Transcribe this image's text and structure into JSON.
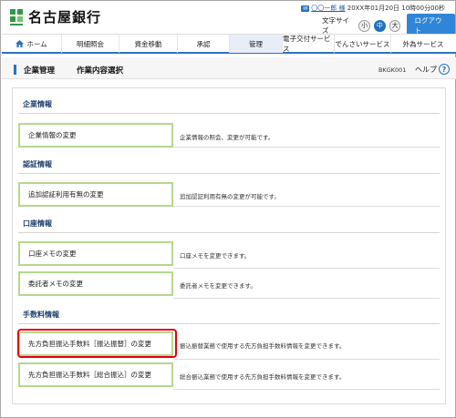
{
  "header": {
    "bank_name": "名古屋銀行",
    "mail_badge": "✉",
    "user_name": "〇〇一郎 様",
    "last_login": "20XX年01月20日 10時00分00秒",
    "font_size_label": "文字サイズ",
    "font_sizes": [
      "小",
      "中",
      "大"
    ],
    "selected_font_size": "中",
    "logout_label": "ログアウト"
  },
  "nav": {
    "items": [
      "ホーム",
      "明細照会",
      "資金移動",
      "承認",
      "管理",
      "電子交付サービス",
      "でんさいサービス",
      "外為サービス"
    ],
    "active": "管理"
  },
  "title": {
    "main": "企業管理",
    "sub": "作業内容選択",
    "screen_id": "BKGK001",
    "help": "ヘルプ",
    "help_icon_glyph": "?"
  },
  "sections": [
    {
      "heading": "企業情報",
      "items": [
        {
          "button": "企業情報の変更",
          "description": "企業情報の照会、変更が可能です。"
        }
      ]
    },
    {
      "heading": "認証情報",
      "items": [
        {
          "button": "追加認証利用有無の変更",
          "description": "追加認証利用有無の変更が可能です。"
        }
      ]
    },
    {
      "heading": "口座情報",
      "items": [
        {
          "button": "口座メモの変更",
          "description": "口座メモを変更できます。"
        },
        {
          "button": "委託者メモの変更",
          "description": "委託者メモを変更できます。"
        }
      ]
    },
    {
      "heading": "手数料情報",
      "items": [
        {
          "button": "先方負担振込手数料［振込振替］の変更",
          "description": "振込振替業務で使用する先方負担手数料情報を変更できます。"
        },
        {
          "button": "先方負担振込手数料［総合振込］の変更",
          "description": "総合振込業務で使用する先方負担手数料情報を変更できます。"
        }
      ]
    }
  ],
  "colors": {
    "brand_blue": "#2c72bf",
    "button_border_green": "#b4d88e",
    "highlight_red": "#e60012",
    "logo_green": "#2e9a45"
  },
  "icons": {
    "logo": "bank-logo-icon",
    "home": "home-icon",
    "help": "help-icon",
    "mail": "mail-icon"
  }
}
